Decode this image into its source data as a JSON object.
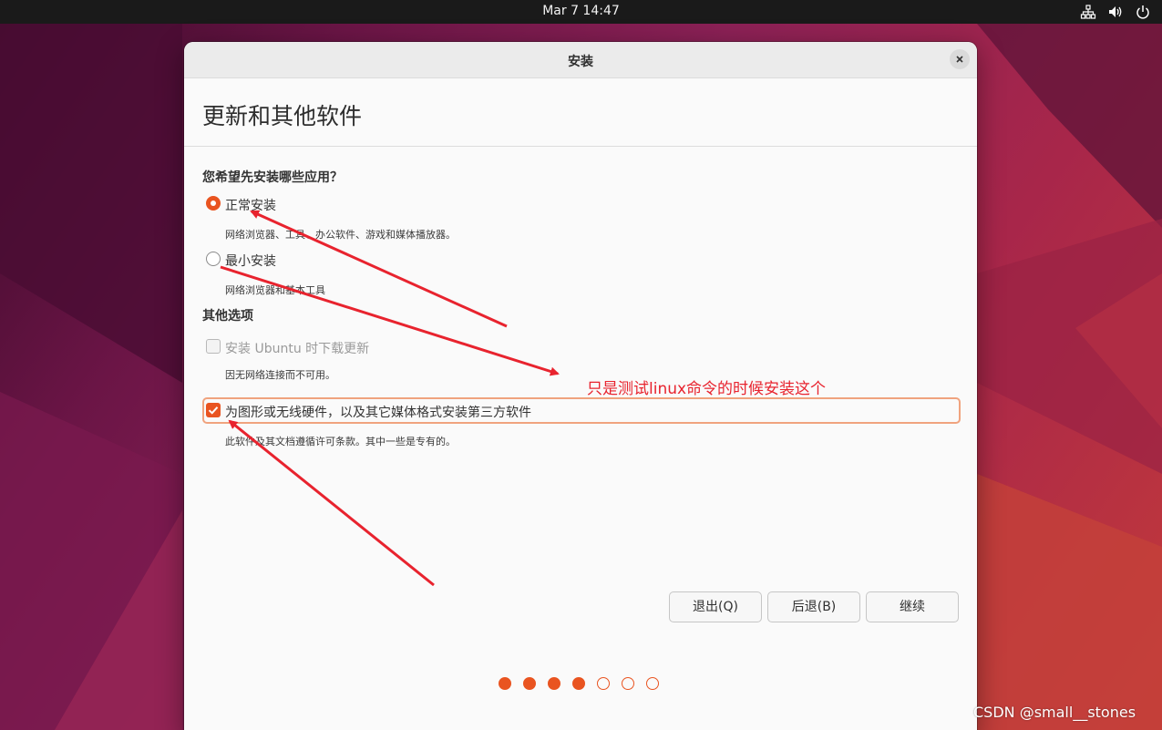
{
  "topbar": {
    "clock": "Mar 7  14:47",
    "tray_icons": [
      "network-icon",
      "volume-icon",
      "power-icon"
    ]
  },
  "window": {
    "title": "安装",
    "close_icon": "close-icon"
  },
  "page": {
    "title": "更新和其他软件"
  },
  "apps_section": {
    "heading": "您希望先安装哪些应用？",
    "options": [
      {
        "label": "正常安装",
        "desc": "网络浏览器、工具、办公软件、游戏和媒体播放器。",
        "selected": true
      },
      {
        "label": "最小安装",
        "desc": "网络浏览器和基本工具",
        "selected": false
      }
    ]
  },
  "other_section": {
    "heading": "其他选项",
    "download_updates": {
      "label": "安装 Ubuntu 时下载更新",
      "desc": "因无网络连接而不可用。",
      "checked": false,
      "enabled": false
    },
    "third_party": {
      "label": "为图形或无线硬件，以及其它媒体格式安装第三方软件",
      "desc": "此软件及其文档遵循许可条款。其中一些是专有的。",
      "checked": true
    }
  },
  "buttons": {
    "quit": "退出(Q)",
    "back": "后退(B)",
    "continue": "继续"
  },
  "progress": {
    "total_steps": 7,
    "completed_steps": 4
  },
  "annotation": {
    "text": "只是测试linux命令的时候安装这个",
    "color": "#e8232e"
  },
  "watermark": "CSDN @small__stones",
  "colors": {
    "accent": "#e95420",
    "topbar": "#1a1a1a"
  }
}
